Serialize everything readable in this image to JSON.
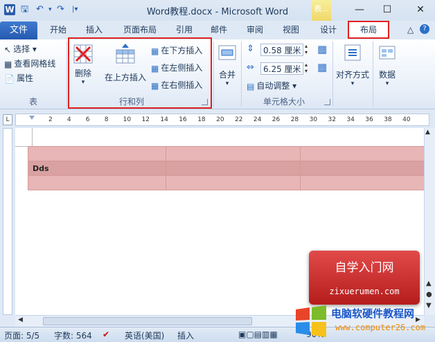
{
  "window": {
    "title": "Word教程.docx - Microsoft Word",
    "context_tab": "表..."
  },
  "tabs": [
    {
      "label": "文件"
    },
    {
      "label": "开始"
    },
    {
      "label": "插入"
    },
    {
      "label": "页面布局"
    },
    {
      "label": "引用"
    },
    {
      "label": "邮件"
    },
    {
      "label": "审阅"
    },
    {
      "label": "视图"
    },
    {
      "label": "设计"
    },
    {
      "label": "布局"
    }
  ],
  "ribbon": {
    "table_group": {
      "label": "表",
      "select": "选择",
      "gridlines": "查看网格线",
      "properties": "属性"
    },
    "rows_cols_group": {
      "label": "行和列",
      "delete": "删除",
      "insert_above": "在上方插入",
      "insert_below": "在下方插入",
      "insert_left": "在左侧插入",
      "insert_right": "在右侧插入"
    },
    "merge_group": {
      "merge": "合并"
    },
    "cell_size_group": {
      "label": "单元格大小",
      "height": "0.58 厘米",
      "width": "6.25 厘米",
      "autofit": "自动调整"
    },
    "align_group": {
      "align": "对齐方式"
    },
    "data_group": {
      "data": "数据"
    }
  },
  "ruler": {
    "ticks": [
      "2",
      "4",
      "6",
      "8",
      "10",
      "12",
      "14",
      "16",
      "18",
      "20",
      "22",
      "24",
      "26",
      "28",
      "30",
      "32",
      "34",
      "36",
      "38",
      "40"
    ]
  },
  "document": {
    "table": {
      "rows": [
        [
          "",
          "",
          ""
        ],
        [
          "Dds",
          "",
          ""
        ],
        [
          "",
          "",
          ""
        ]
      ]
    }
  },
  "status": {
    "page": "页面: 5/5",
    "words": "字数: 564",
    "language": "英语(美国)",
    "mode": "插入",
    "zoom": "90%"
  },
  "watermark": {
    "line1": "自学入门网",
    "line2": "zixuerumen.com",
    "line3": "电脑软硬件教程网",
    "line4": "www.computer26.com"
  }
}
